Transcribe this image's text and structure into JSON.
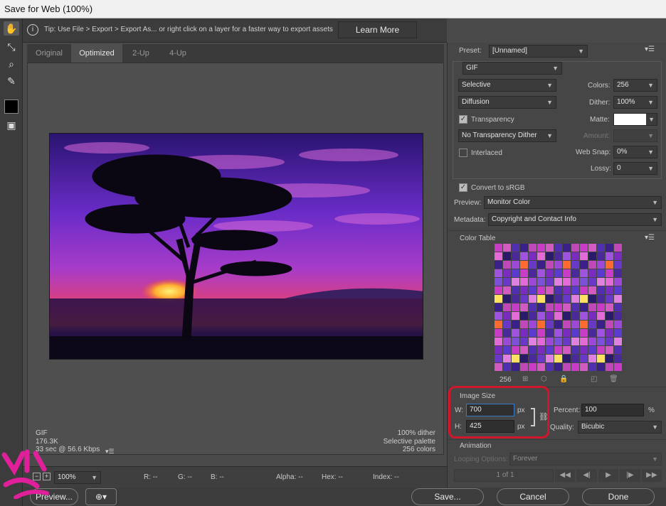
{
  "window": {
    "title": "Save for Web (100%)"
  },
  "tip": {
    "text": "Tip: Use File > Export > Export As...  or right click on a layer for a faster way to export assets",
    "learn_more": "Learn More"
  },
  "tabs": [
    "Original",
    "Optimized",
    "2-Up",
    "4-Up"
  ],
  "image_info": {
    "left": [
      "GIF",
      "176.3K",
      "33 sec @ 56.6 Kbps"
    ],
    "right": [
      "100% dither",
      "Selective palette",
      "256 colors"
    ]
  },
  "status": {
    "zoom": "100%",
    "r": "R: --",
    "g": "G: --",
    "b": "B: --",
    "alpha": "Alpha: --",
    "hex": "Hex: --",
    "index": "Index: --"
  },
  "bottom": {
    "preview": "Preview...",
    "save": "Save...",
    "cancel": "Cancel",
    "done": "Done"
  },
  "settings": {
    "preset_label": "Preset:",
    "preset_value": "[Unnamed]",
    "format": "GIF",
    "reduction": "Selective",
    "dither_algo": "Diffusion",
    "transparency": "Transparency",
    "transparency_dither": "No Transparency Dither",
    "interlaced": "Interlaced",
    "colors_label": "Colors:",
    "colors_value": "256",
    "dither_label": "Dither:",
    "dither_value": "100%",
    "matte_label": "Matte:",
    "amount_label": "Amount:",
    "websnap_label": "Web Snap:",
    "websnap_value": "0%",
    "lossy_label": "Lossy:",
    "lossy_value": "0",
    "convert_srgb": "Convert to sRGB",
    "preview_label": "Preview:",
    "preview_value": "Monitor Color",
    "metadata_label": "Metadata:",
    "metadata_value": "Copyright and Contact Info"
  },
  "color_table": {
    "title": "Color Table",
    "count": "256",
    "colors": [
      "#c83cc8",
      "#7a2cc0",
      "#4a2a9a",
      "#e46ad8",
      "#6a38c8",
      "#9e48d8",
      "#3b1f8a",
      "#d25ac0",
      "#5b3ad0",
      "#a052e0",
      "#2a1a6a",
      "#e080e0",
      "#7c50d8",
      "#c048b8",
      "#5030b0"
    ]
  },
  "image_size": {
    "title": "Image Size",
    "w_label": "W:",
    "w_value": "700",
    "h_label": "H:",
    "h_value": "425",
    "unit": "px",
    "percent_label": "Percent:",
    "percent_value": "100",
    "percent_unit": "%",
    "quality_label": "Quality:",
    "quality_value": "Bicubic"
  },
  "animation": {
    "title": "Animation",
    "looping_label": "Looping Options:",
    "looping_value": "Forever",
    "frame": "1 of 1"
  },
  "accent_colors": {
    "highlight": "#d0162b",
    "logo": "#e0209a"
  }
}
